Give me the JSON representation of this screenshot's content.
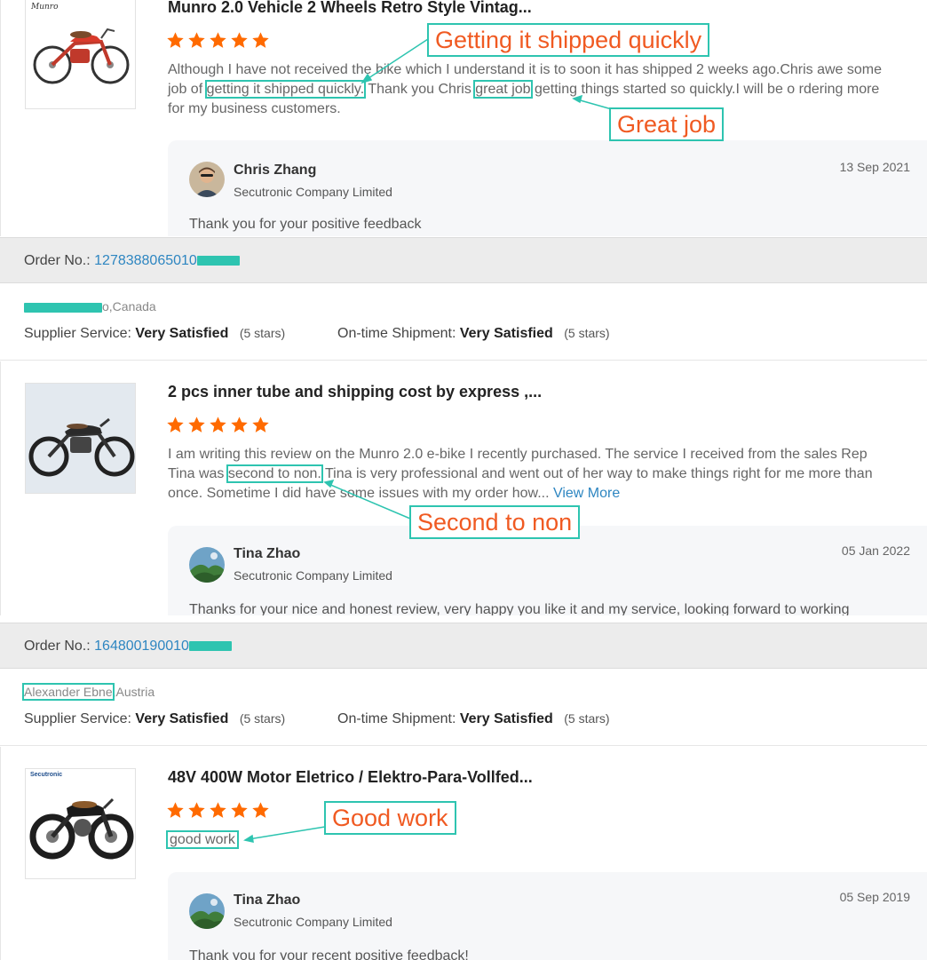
{
  "reviews": [
    {
      "product_title": "Munro 2.0 Vehicle 2 Wheels Retro Style Vintag...",
      "thumb_brand": "Munro",
      "stars": 5,
      "text_parts": [
        "Although I have not received the bike which I understand it is to soon it has shipped 2 weeks ago.Chris awe some job of ",
        "getting it shipped quickly.",
        " Thank you Chris ",
        "great job",
        " getting things started so quickly.I will be o rdering more for my business customers."
      ],
      "reply": {
        "name": "Chris Zhang",
        "company": "Secutronic Company Limited",
        "date": "13 Sep 2021",
        "text": "Thank you for your positive feedback"
      }
    },
    {
      "order_label": "Order No.:",
      "order_number": "1278388065010",
      "buyer_location": "o,Canada",
      "supplier_service_label": "Supplier Service:",
      "supplier_service_value": "Very Satisfied",
      "supplier_service_stars": "(5 stars)",
      "shipment_label": "On-time Shipment:",
      "shipment_value": "Very Satisfied",
      "shipment_stars": "(5 stars)",
      "product_title": "2 pcs inner tube and shipping cost by express ,...",
      "stars": 5,
      "text_parts": [
        "I am writing this review on the Munro 2.0 e-bike I recently purchased. The service I received from the sales Rep Tina was ",
        "second to non.",
        " Tina is very professional and went out of her way to make things right for me more than once. Sometime I did have some issues with my order how... "
      ],
      "view_more": "View More",
      "reply": {
        "name": "Tina Zhao",
        "company": "Secutronic Company Limited",
        "date": "05 Jan 2022",
        "text": "Thanks for your nice and honest review, very happy you like it and my service, looking forward to working"
      }
    },
    {
      "order_label": "Order No.:",
      "order_number": "164800190010",
      "buyer_name": "Alexander Ebne",
      "buyer_location": ",Austria",
      "supplier_service_label": "Supplier Service:",
      "supplier_service_value": "Very Satisfied",
      "supplier_service_stars": "(5 stars)",
      "shipment_label": "On-time Shipment:",
      "shipment_value": "Very Satisfied",
      "shipment_stars": "(5 stars)",
      "product_title": "48V 400W Motor Eletrico / Elektro-Para-Vollfed...",
      "thumb_brand": "Secutronic",
      "stars": 5,
      "text": "good work",
      "reply": {
        "name": "Tina Zhao",
        "company": "Secutronic Company Limited",
        "date": "05 Sep 2019",
        "text": "Thank you for your recent positive feedback!"
      }
    }
  ],
  "callouts": {
    "shipped": "Getting it shipped quickly",
    "great_job": "Great job",
    "second_to_non": "Second to non",
    "good_work": "Good work"
  },
  "colors": {
    "star": "#ff6a00",
    "highlight": "#2ec4b0",
    "callout_text": "#f05a22",
    "link": "#2e86c1"
  }
}
